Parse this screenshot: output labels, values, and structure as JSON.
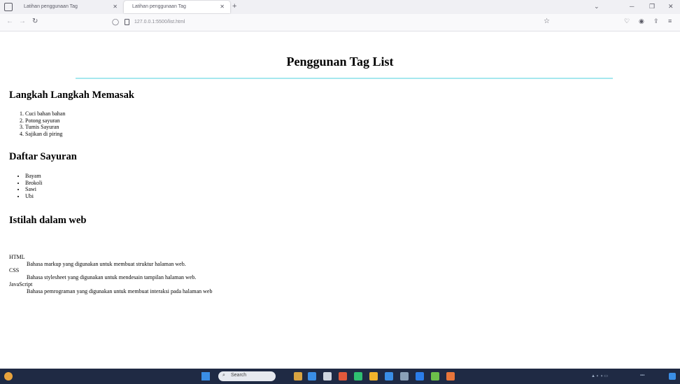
{
  "browser": {
    "tabs": [
      {
        "label": "Latihan penggunaan Tag"
      },
      {
        "label": "Latihan penggunaan Tag"
      }
    ],
    "url": "127.0.0.1:5500/list.html"
  },
  "page": {
    "title": "Penggunan Tag List",
    "rule_color": "#a6e8ee",
    "sections": [
      {
        "heading": "Langkah Langkah Memasak",
        "items": [
          "Cuci bahan bahan",
          "Potong sayuran",
          "Tumis Sayuran",
          "Sajikan di piring"
        ]
      },
      {
        "heading": "Daftar Sayuran",
        "items": [
          "Bayam",
          "Brokoli",
          "Sawi",
          "Ubi"
        ]
      },
      {
        "heading": "Istilah dalam web",
        "terms": [
          {
            "term": "HTML",
            "desc": "Bahasa markup yang digunakan untuk membuat struktur halaman web."
          },
          {
            "term": "CSS",
            "desc": "Bahasa stylesheet yang digunakan untuk mendesain tampilan halaman web."
          },
          {
            "term": "JavaScript",
            "desc": "Bahasa pemrograman yang digunakan untuk membuat interaksi pada halaman web"
          }
        ]
      }
    ]
  },
  "taskbar": {
    "search_label": "Search"
  }
}
